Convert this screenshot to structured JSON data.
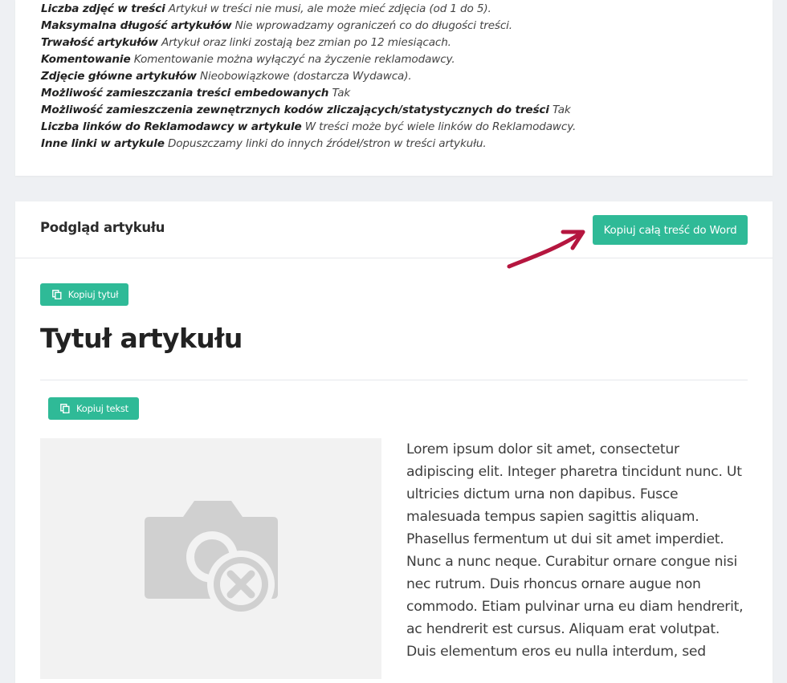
{
  "specs": [
    {
      "label": "Liczba zdjęć w treści",
      "value": "Artykuł w treści nie musi, ale może mieć zdjęcia (od 1 do 5)."
    },
    {
      "label": "Maksymalna długość artykułów",
      "value": "Nie wprowadzamy ograniczeń co do długości treści."
    },
    {
      "label": "Trwałość artykułów",
      "value": "Artykuł oraz linki zostają bez zmian po 12 miesiącach."
    },
    {
      "label": "Komentowanie",
      "value": "Komentowanie można wyłączyć na życzenie reklamodawcy."
    },
    {
      "label": "Zdjęcie główne artykułów",
      "value": "Nieobowiązkowe (dostarcza Wydawca)."
    },
    {
      "label": "Możliwość zamieszczania treści embedowanych",
      "value": "Tak"
    },
    {
      "label": "Możliwość zamieszczenia zewnętrznych kodów zliczających/statystycznych do treści",
      "value": "Tak"
    },
    {
      "label": "Liczba linków do Reklamodawcy w artykule",
      "value": "W treści może być wiele linków do Reklamodawcy."
    },
    {
      "label": "Inne linki w artykule",
      "value": "Dopuszczamy linki do innych źródeł/stron w treści artykułu."
    }
  ],
  "preview": {
    "header_title": "Podgląd artykułu",
    "copy_word_label": "Kopiuj całą treść do Word",
    "copy_title_label": "Kopiuj tytuł",
    "article_title": "Tytuł artykułu",
    "copy_text_label": "Kopiuj tekst",
    "body_text": "Lorem ipsum dolor sit amet, consectetur adipiscing elit. Integer pharetra tincidunt nunc. Ut ultricies dictum urna non dapibus. Fusce malesuada tempus sapien sagittis aliquam. Phasellus fermentum ut dui sit amet imperdiet. Nunc a nunc neque. Curabitur ornare congue nisi nec rutrum. Duis rhoncus ornare augue non commodo. Etiam pulvinar urna eu diam hendrerit, ac hendrerit est cursus. Aliquam erat volutpat. Duis elementum eros eu nulla interdum, sed"
  },
  "icons": {
    "copy": "copy-icon",
    "arrow": "arrow-icon",
    "image_missing": "image-missing-icon"
  },
  "colors": {
    "accent": "#2fba97",
    "arrow": "#b5163f",
    "placeholder_bg": "#f2f2f2",
    "placeholder_icon": "#d0d0d0"
  }
}
